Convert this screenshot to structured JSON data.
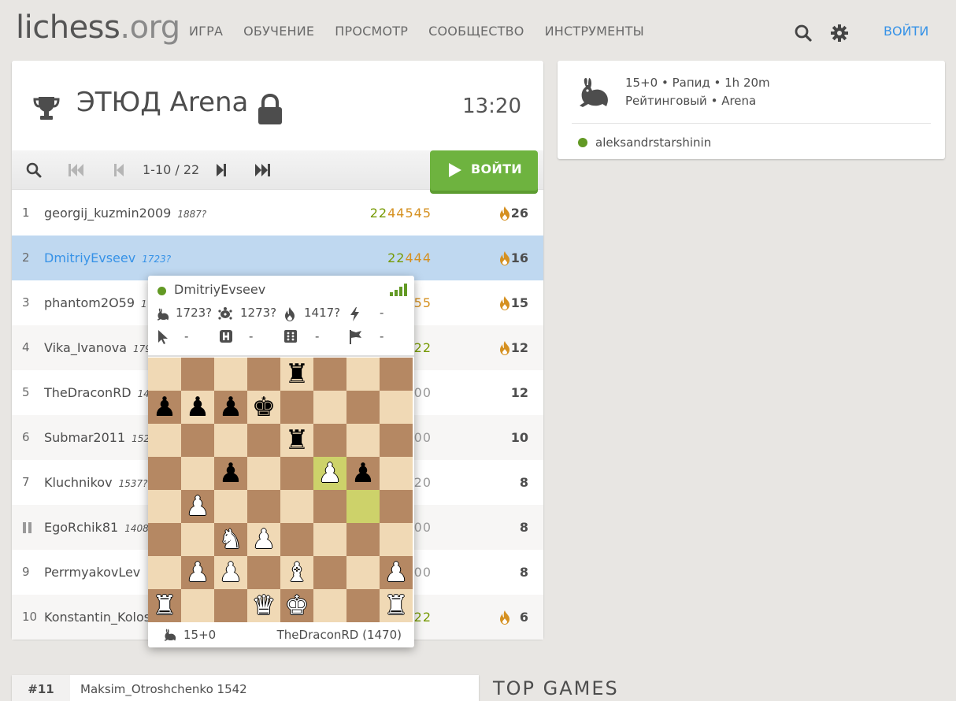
{
  "header": {
    "logo_main": "lichess",
    "logo_tld": ".org",
    "nav": [
      "ИГРА",
      "ОБУЧЕНИЕ",
      "ПРОСМОТР",
      "СООБЩЕСТВО",
      "ИНСТРУМЕНТЫ"
    ],
    "search_icon": "search-icon",
    "settings_icon": "gear-icon",
    "login": "ВОЙТИ"
  },
  "tournament": {
    "title": "ЭТЮД Arena",
    "clock": "13:20",
    "icons": [
      "trophy-icon",
      "lock-icon"
    ],
    "pager_info": "1-10 / 22",
    "join_label": "ВОЙТИ"
  },
  "standings": [
    {
      "rank": "1",
      "name": "georgij_kuzmin2009",
      "rating": "1887?",
      "sheet": [
        {
          "t": "2",
          "c": "w"
        },
        {
          "t": "2",
          "c": "w"
        },
        {
          "t": "4",
          "c": "d"
        },
        {
          "t": "4",
          "c": "d"
        },
        {
          "t": "5",
          "c": "d"
        },
        {
          "t": "4",
          "c": "d"
        },
        {
          "t": "5",
          "c": "d"
        }
      ],
      "fire": true,
      "score": "26"
    },
    {
      "rank": "2",
      "name": "DmitriyEvseev",
      "rating": "1723?",
      "sheet": [
        {
          "t": "2",
          "c": "w"
        },
        {
          "t": "2",
          "c": "w"
        },
        {
          "t": "4",
          "c": "d"
        },
        {
          "t": "4",
          "c": "d"
        },
        {
          "t": "4",
          "c": "d"
        }
      ],
      "fire": true,
      "score": "16"
    },
    {
      "rank": "3",
      "name": "phantom2O59",
      "rating": "1",
      "sheet": [
        {
          "t": "5",
          "c": "d"
        },
        {
          "t": "5",
          "c": "d"
        }
      ],
      "fire": true,
      "score": "15"
    },
    {
      "rank": "4",
      "name": "Vika_Ivanova",
      "rating": "179",
      "sheet": [
        {
          "t": "2",
          "c": "w"
        },
        {
          "t": "2",
          "c": "w"
        }
      ],
      "fire": true,
      "score": "12"
    },
    {
      "rank": "5",
      "name": "TheDraconRD",
      "rating": "14",
      "sheet": [
        {
          "t": "0",
          "c": "n"
        },
        {
          "t": "0",
          "c": "n"
        }
      ],
      "fire": false,
      "score": "12"
    },
    {
      "rank": "6",
      "name": "Submar2011",
      "rating": "152",
      "sheet": [
        {
          "t": "0",
          "c": "n"
        },
        {
          "t": "0",
          "c": "n"
        }
      ],
      "fire": false,
      "score": "10"
    },
    {
      "rank": "7",
      "name": "Kluchnikov",
      "rating": "1537?",
      "sheet": [
        {
          "t": "2",
          "c": "n"
        },
        {
          "t": "0",
          "c": "n"
        }
      ],
      "fire": false,
      "score": "8"
    },
    {
      "rank": "",
      "paused": true,
      "name": "EgoRchik81",
      "rating": "1408",
      "sheet": [
        {
          "t": "0",
          "c": "n"
        },
        {
          "t": "0",
          "c": "n"
        }
      ],
      "fire": false,
      "score": "8"
    },
    {
      "rank": "9",
      "name": "PerrmyakovLev",
      "rating": "",
      "sheet": [
        {
          "t": "0",
          "c": "n"
        },
        {
          "t": "0",
          "c": "n"
        }
      ],
      "fire": false,
      "score": "8"
    },
    {
      "rank": "10",
      "name": "Konstantin_Kolosh",
      "rating": "",
      "sheet": [
        {
          "t": "2",
          "c": "w"
        },
        {
          "t": "2",
          "c": "w"
        }
      ],
      "fire": true,
      "score": "6"
    }
  ],
  "side": {
    "setup_line1": "15+0 • Рапид • 1h 20m",
    "setup_line2": "Рейтинговый • Arena",
    "creator": "aleksandrstarshinin",
    "icon": "rabbit-icon"
  },
  "bottom": {
    "rank": "#11",
    "name": "Maksim_Otroshchenko 1542",
    "top_games": "TOP GAMES"
  },
  "popup": {
    "name": "DmitriyEvseev",
    "perfs_row1": [
      "1723?",
      "1273?",
      "1417?",
      "-"
    ],
    "perfs_row2": [
      "-",
      "-",
      "-",
      "-"
    ],
    "clock": "15+0",
    "opponent": "TheDraconRD (1470)",
    "board_fen_rows": [
      "....r...",
      "pppk....",
      "....r...",
      "..p..Pp.",
      ".P......",
      "..NP....",
      ".PP.B..P",
      "R..QK..R"
    ],
    "highlight_squares": [
      "f5",
      "g4"
    ],
    "colors": {
      "light": "#f0d9b5",
      "dark": "#b58863",
      "highlight": "#cdd26a",
      "accent": "#6eb33f",
      "link": "#3692e7",
      "win": "#759900",
      "streak": "#d59020"
    }
  }
}
